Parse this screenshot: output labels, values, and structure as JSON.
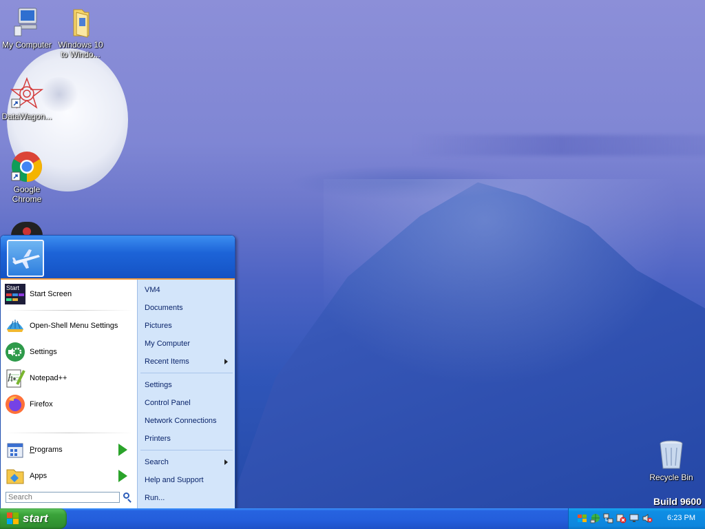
{
  "desktop": {
    "icons": [
      {
        "label": "My Computer"
      },
      {
        "label": "Windows 10 to Windo..."
      },
      {
        "label": "DataWagon..."
      },
      {
        "label": "Google Chrome"
      },
      {
        "label": "Recycle Bin"
      }
    ],
    "watermark": "Build 9600"
  },
  "start_menu": {
    "left_items": [
      {
        "label": "Start Screen",
        "icon": "start-screen-icon"
      },
      {
        "label": "Open-Shell Menu Settings",
        "icon": "shell-icon"
      },
      {
        "label": "Settings",
        "icon": "settings-icon"
      },
      {
        "label": "Notepad++",
        "icon": "notepad-icon"
      },
      {
        "label": "Firefox",
        "icon": "firefox-icon"
      },
      {
        "label": "Programs",
        "icon": "programs-icon"
      },
      {
        "label": "Apps",
        "icon": "apps-icon"
      }
    ],
    "start_screen_tile_text": "Start",
    "search": {
      "placeholder": "Search"
    },
    "right_items": [
      {
        "label": "VM4"
      },
      {
        "label": "Documents"
      },
      {
        "label": "Pictures"
      },
      {
        "label": "My Computer"
      },
      {
        "label": "Recent Items"
      },
      {
        "label": "Settings"
      },
      {
        "label": "Control Panel"
      },
      {
        "label": "Network Connections"
      },
      {
        "label": "Printers"
      },
      {
        "label": "Search"
      },
      {
        "label": "Help and Support"
      },
      {
        "label": "Run..."
      }
    ]
  },
  "taskbar": {
    "start_label": "start",
    "clock": "6:23 PM",
    "tray_icons": [
      "flag-icon",
      "network-globe-icon",
      "network-icon",
      "security-alert-icon",
      "display-icon",
      "volume-muted-icon"
    ]
  },
  "colors": {
    "taskbar_blue": "#245edb",
    "start_green": "#3aa33a",
    "tray_blue": "#0f8ee4",
    "menu_right_panel": "#d3e5fa",
    "menu_header": "#1d64d8",
    "menu_accent_orange": "#f29a3c"
  }
}
